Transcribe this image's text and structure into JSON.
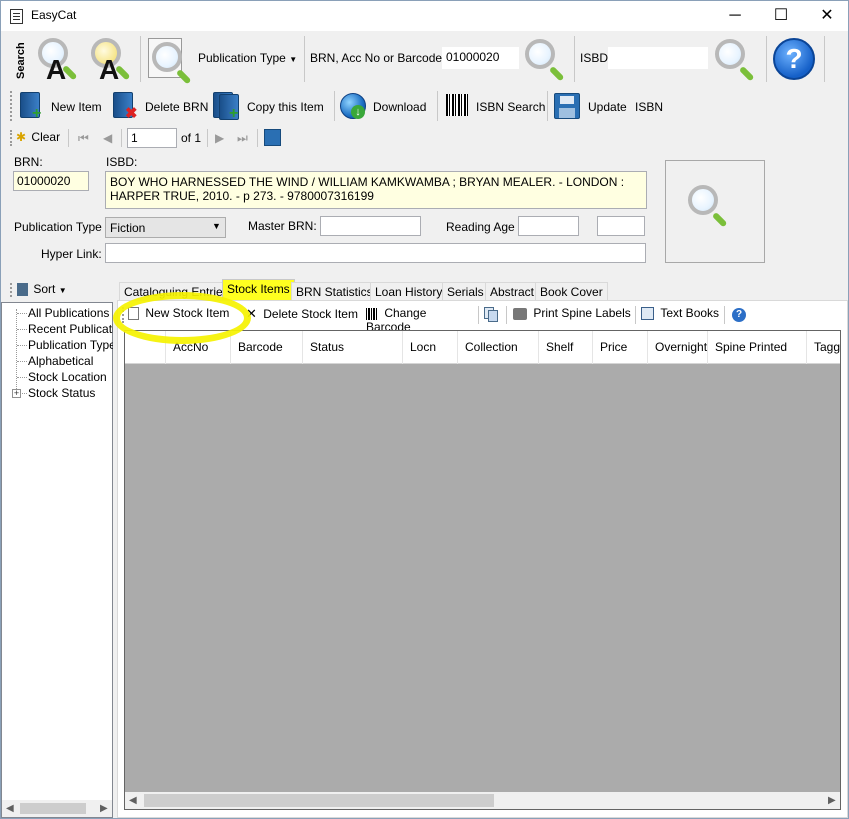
{
  "window": {
    "title": "EasyCat",
    "minimize": "─",
    "maximize": "☐",
    "close": "✕"
  },
  "search_toolbar": {
    "vertical_label": "Search",
    "publication_type_label": "Publication Type",
    "brn_label": "BRN, Acc No or Barcode",
    "brn_value": "01000020",
    "isbd_label": "ISBD",
    "isbd_value": "",
    "help_label": "?"
  },
  "main_toolbar": {
    "new_item": "New Item",
    "delete_brn": "Delete BRN",
    "copy_item": "Copy this Item",
    "download": "Download",
    "isbn_search": "ISBN Search",
    "update": "Update",
    "isbn": "ISBN"
  },
  "nav_toolbar": {
    "clear": "Clear",
    "first": "⏮",
    "prev": "◀",
    "position": "1",
    "of_total": "of 1",
    "next": "▶",
    "last": "⏭"
  },
  "record": {
    "brn_label": "BRN:",
    "brn_value": "01000020",
    "isbd_label": "ISBD:",
    "isbd_value": "BOY WHO HARNESSED THE WIND / WILLIAM KAMKWAMBA ; BRYAN MEALER. - LONDON : HARPER TRUE, 2010. - p 273. - 9780007316199",
    "publication_type_label": "Publication Type",
    "publication_type_value": "Fiction",
    "master_brn_label": "Master BRN:",
    "master_brn_value": "",
    "reading_age_label": "Reading Age",
    "reading_age_from": "",
    "reading_age_to": "",
    "hyperlink_label": "Hyper Link:",
    "hyperlink_value": ""
  },
  "sidebar": {
    "sort_label": "Sort",
    "items": [
      {
        "label": "All Publications"
      },
      {
        "label": "Recent Publications"
      },
      {
        "label": "Publication Types"
      },
      {
        "label": "Alphabetical"
      },
      {
        "label": "Stock Location"
      },
      {
        "label": "Stock Status"
      }
    ]
  },
  "tabs": [
    {
      "label": "Cataloguing Entries"
    },
    {
      "label": "Stock Items"
    },
    {
      "label": "BRN Statistics"
    },
    {
      "label": "Loan History"
    },
    {
      "label": "Serials"
    },
    {
      "label": "Abstract"
    },
    {
      "label": "Book Cover"
    }
  ],
  "stock_toolbar": {
    "new_stock_item": "New Stock Item",
    "delete_stock_item": "Delete Stock Item",
    "change_barcode": "Change Barcode",
    "print_spine_labels": "Print Spine Labels",
    "text_books": "Text Books"
  },
  "stock_grid": {
    "columns": [
      "",
      "AccNo",
      "Barcode",
      "Status",
      "Locn",
      "Collection",
      "Shelf",
      "Price",
      "Overnight",
      "Spine Printed",
      "Tagged"
    ],
    "rows": []
  },
  "colors": {
    "highlight": "#f5f200",
    "input_yellow": "#ffffe1",
    "grid_background": "#ababab"
  }
}
